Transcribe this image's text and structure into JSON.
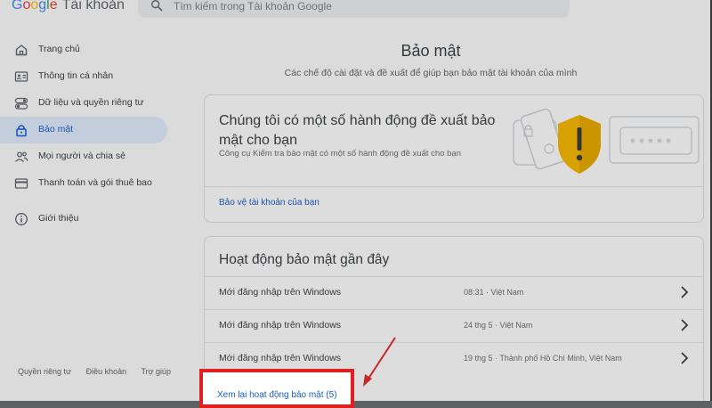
{
  "header": {
    "logo_letters": [
      "G",
      "o",
      "o",
      "g",
      "l",
      "e"
    ],
    "product": "Tài khoản",
    "search_placeholder": "Tìm kiếm trong Tài khoản Google"
  },
  "sidebar": {
    "items": [
      {
        "label": "Trang chủ",
        "icon": "home-icon"
      },
      {
        "label": "Thông tin cá nhân",
        "icon": "id-card-icon"
      },
      {
        "label": "Dữ liệu và quyền riêng tư",
        "icon": "privacy-toggle-icon"
      },
      {
        "label": "Bảo mật",
        "icon": "lock-icon",
        "active": true
      },
      {
        "label": "Mọi người và chia sẻ",
        "icon": "people-icon"
      },
      {
        "label": "Thanh toán và gói thuê bao",
        "icon": "credit-card-icon"
      },
      {
        "label": "Giới thiệu",
        "icon": "info-icon"
      }
    ],
    "footer": [
      "Quyền riêng tư",
      "Điều khoản",
      "Trợ giúp"
    ]
  },
  "main": {
    "title": "Bảo mật",
    "subtitle": "Các chế độ cài đặt và đề xuất để giúp bạn bảo mật tài khoản của mình",
    "recommendation_card": {
      "title": "Chúng tôi có một số hành động đề xuất bảo mật cho bạn",
      "description": "Công cụ Kiểm tra bảo mật có một số hành động đề xuất cho bạn",
      "link": "Bảo vệ tài khoản của bạn",
      "illustration": "shield-warning-icon"
    },
    "activity_card": {
      "title": "Hoạt động bảo mật gần đây",
      "rows": [
        {
          "text": "Mới đăng nhập trên Windows",
          "meta": "08:31 · Việt Nam"
        },
        {
          "text": "Mới đăng nhập trên Windows",
          "meta": "24 thg 5 · Việt Nam"
        },
        {
          "text": "Mới đăng nhập trên Windows",
          "meta": "19 thg 5 · Thành phố Hồ Chí Minh, Việt Nam"
        }
      ],
      "review_link": "Xem lại hoạt động bảo mật (5)"
    }
  },
  "colors": {
    "accent": "#1a5fc2",
    "active_nav_bg": "#dbe5f5",
    "highlight_border": "#e02020",
    "shield": "#f0b400"
  }
}
